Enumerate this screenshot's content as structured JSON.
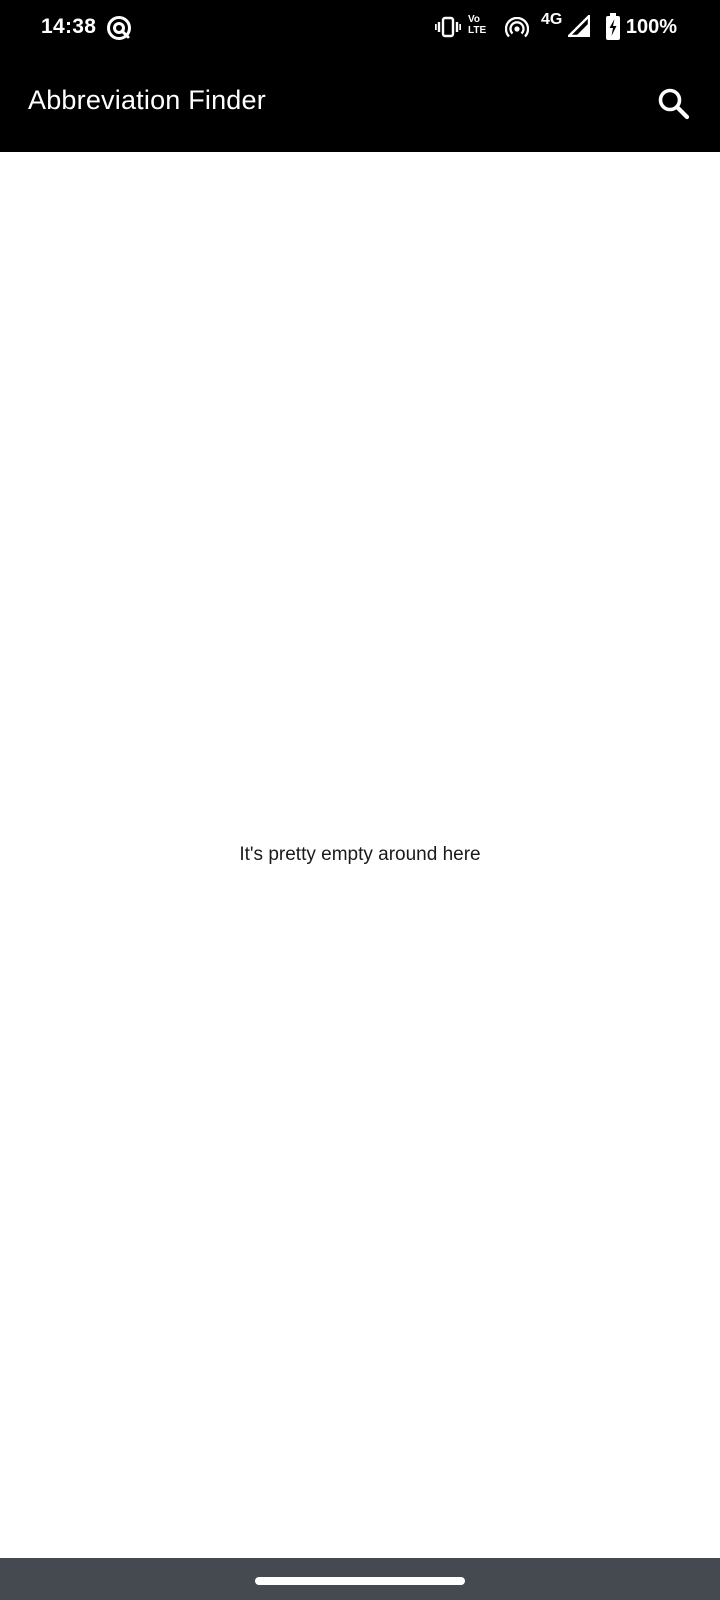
{
  "status_bar": {
    "time": "14:38",
    "volte_top": "Vo",
    "volte_bottom": "LTE",
    "network": "4G",
    "battery": "100%",
    "icons": [
      "sync-app-icon",
      "vibrate-icon",
      "volte-icon",
      "hotspot-icon",
      "signal-icon",
      "battery-charging-icon"
    ]
  },
  "app_bar": {
    "title": "Abbreviation Finder",
    "search_icon": "search-icon"
  },
  "content": {
    "empty_message": "It's pretty empty around here"
  },
  "nav_bar": {
    "home_handle": "home-handle"
  },
  "colors": {
    "app_bar_bg": "#000000",
    "status_bar_bg": "#000000",
    "content_bg": "#ffffff",
    "nav_bar_bg": "#444a50",
    "title_text": "#ffffff",
    "body_text": "#1a1a1a"
  }
}
